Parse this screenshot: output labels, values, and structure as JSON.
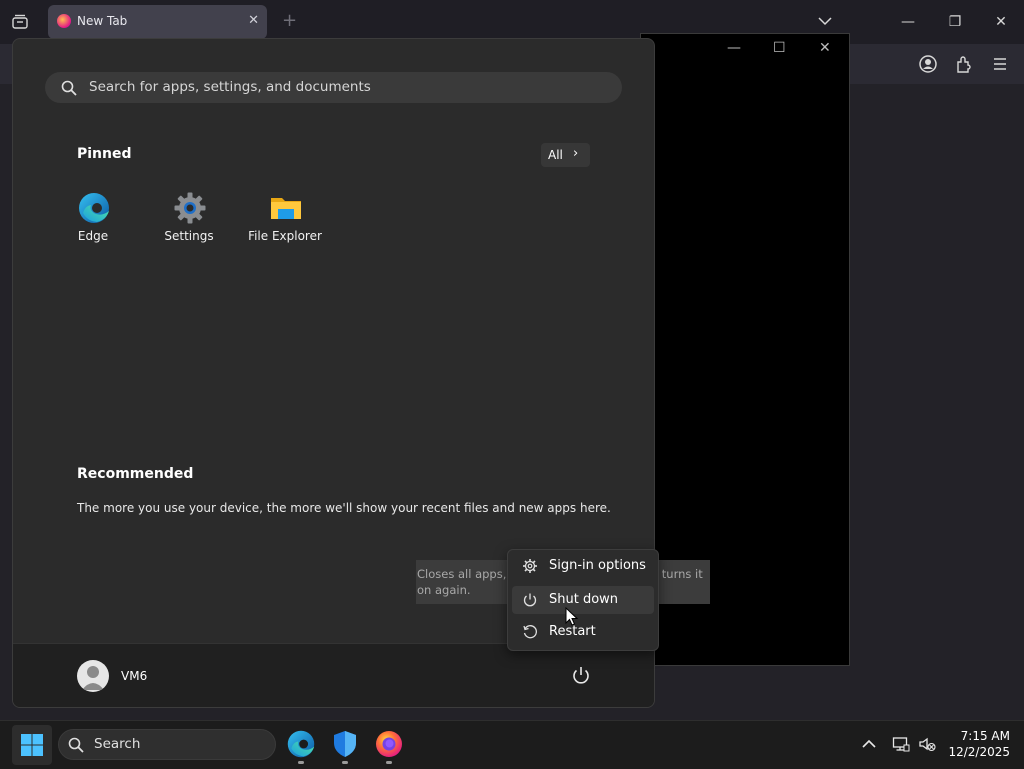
{
  "browser": {
    "tab_title": "New Tab",
    "tab_close_glyph": "✕",
    "new_tab_glyph": "+"
  },
  "start_menu": {
    "search": {
      "placeholder": "Search for apps, settings, and documents"
    },
    "pinned": {
      "title": "Pinned",
      "all_label": "All",
      "all_chevron": "›",
      "apps": [
        {
          "label": "Edge",
          "icon": "edge-icon"
        },
        {
          "label": "Settings",
          "icon": "settings-gear-icon"
        },
        {
          "label": "File Explorer",
          "icon": "folder-icon"
        }
      ]
    },
    "recommended": {
      "title": "Recommended",
      "text": "The more you use your device, the more we'll show your recent files and new apps here."
    },
    "user": {
      "name": "VM6"
    },
    "tooltip": "Closes all apps, turns off the PC, and then turns it on again.",
    "power_menu": {
      "items": [
        {
          "label": "Sign-in options",
          "icon": "gear-icon"
        },
        {
          "label": "Shut down",
          "icon": "power-icon"
        },
        {
          "label": "Restart",
          "icon": "restart-icon"
        }
      ]
    }
  },
  "taskbar": {
    "search_label": "Search",
    "time": "7:15 AM",
    "date": "12/2/2025"
  },
  "colors": {
    "accent": "#0078d4",
    "menu_bg": "#2b2b2b",
    "taskbar_bg": "#1c1c1c"
  }
}
